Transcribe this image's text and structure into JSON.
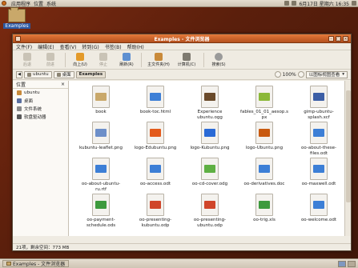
{
  "top_panel": {
    "menus": [
      "应用程序",
      "位置",
      "系统"
    ],
    "clock": "6月17日 星期六 16:35"
  },
  "desktop": {
    "icon_label": "Examples"
  },
  "window": {
    "title": "Examples - 文件浏览器",
    "menus": [
      "文件(F)",
      "编辑(E)",
      "查看(V)",
      "转到(G)",
      "书签(B)",
      "帮助(H)"
    ],
    "toolbar": {
      "back": "后退",
      "forward": "前进",
      "up": "向上(U)",
      "stop": "停止",
      "reload": "刷新(R)",
      "home": "主文件夹(H)",
      "computer": "计算机(C)",
      "search": "搜索(S)"
    },
    "location": {
      "crumbs": [
        "ubuntu",
        "桌面",
        "Examples"
      ],
      "zoom": "100%",
      "view": "以图标视图查看"
    },
    "sidebar": {
      "title": "位置",
      "items": [
        "ubuntu",
        "桌面",
        "文件系统",
        "软盘驱动器"
      ]
    },
    "files": [
      {
        "name": "book",
        "icon": "folder-icon",
        "color": "#c9a86a"
      },
      {
        "name": "book-toc.html",
        "icon": "html-icon",
        "color": "#3d7fd6"
      },
      {
        "name": "Experience ubuntu.ogg",
        "icon": "video-thumbnail-icon",
        "color": "#6a4a2a"
      },
      {
        "name": "fables_01_01_aesop.spx",
        "icon": "audio-icon",
        "color": "#8bb838"
      },
      {
        "name": "gimp-ubuntu-splash.xcf",
        "icon": "image-icon",
        "color": "#3d5fa6"
      },
      {
        "name": "",
        "icon": "",
        "color": ""
      },
      {
        "name": "kubuntu-leaflet.png",
        "icon": "leaflet-thumbnail-icon",
        "color": "#6d8fc9"
      },
      {
        "name": "logo-Edubuntu.png",
        "icon": "edubuntu-logo-icon",
        "color": "#e35a1b"
      },
      {
        "name": "logo-Kubuntu.png",
        "icon": "kubuntu-logo-icon",
        "color": "#2a6ad6"
      },
      {
        "name": "logo-Ubuntu.png",
        "icon": "ubuntu-logo-icon",
        "color": "#c95a10"
      },
      {
        "name": "oo-about-these-files.odt",
        "icon": "document-icon",
        "color": "#3d7fd6"
      },
      {
        "name": "",
        "icon": "",
        "color": ""
      },
      {
        "name": "oo-about-ubuntu-ru.rtf",
        "icon": "document-icon",
        "color": "#3d7fd6"
      },
      {
        "name": "oo-access.odt",
        "icon": "document-icon",
        "color": "#3d7fd6"
      },
      {
        "name": "oo-cd-cover.odg",
        "icon": "drawing-icon",
        "color": "#5fb043"
      },
      {
        "name": "oo-derivatives.doc",
        "icon": "document-icon",
        "color": "#3d7fd6"
      },
      {
        "name": "oo-maxwell.odt",
        "icon": "document-icon",
        "color": "#3d7fd6"
      },
      {
        "name": "",
        "icon": "",
        "color": ""
      },
      {
        "name": "oo-payment-schedule.ods",
        "icon": "spreadsheet-icon",
        "color": "#3d9a3d"
      },
      {
        "name": "oo-presenting-kubuntu.odp",
        "icon": "presentation-icon",
        "color": "#d0452a"
      },
      {
        "name": "oo-presenting-ubuntu.odp",
        "icon": "presentation-icon",
        "color": "#d0452a"
      },
      {
        "name": "oo-trig.xls",
        "icon": "spreadsheet-icon",
        "color": "#3d9a3d"
      },
      {
        "name": "oo-welcome.odt",
        "icon": "document-icon",
        "color": "#3d7fd6"
      }
    ],
    "status": "21项，剩余空间：773 MB"
  },
  "taskbar": {
    "task_label": "Examples - 文件浏览器"
  }
}
